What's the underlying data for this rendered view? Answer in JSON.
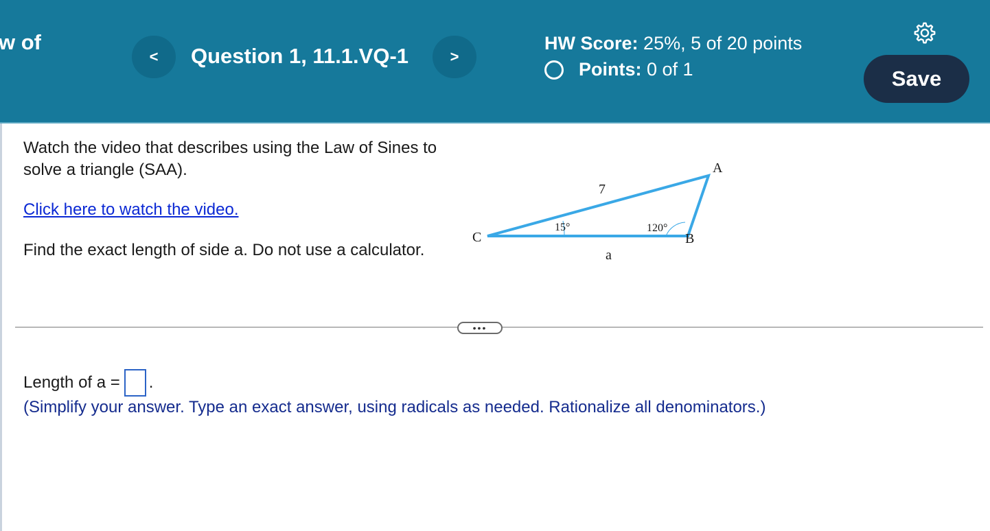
{
  "header": {
    "question_count_fragment": "w of",
    "prev_label": "<",
    "next_label": ">",
    "question_title": "Question 1, 11.1.VQ-1",
    "hw_score_label": "HW Score:",
    "hw_score_value": "25%, 5 of 20 points",
    "points_label": "Points:",
    "points_value": "0 of 1",
    "save_label": "Save",
    "settings_icon": "gear-icon"
  },
  "question": {
    "intro": "Watch the video that describes using the Law of Sines to solve a triangle (SAA).",
    "video_link": "Click here to watch the video.",
    "prompt": "Find the exact length of side a. Do not use a calculator."
  },
  "figure": {
    "vertex_a": "A",
    "vertex_b": "B",
    "vertex_c": "C",
    "side_ca": "7",
    "side_cb": "a",
    "angle_c": "15°",
    "angle_b": "120°",
    "stroke_color": "#3aa8e6"
  },
  "divider": {
    "more_label": "•••"
  },
  "answer": {
    "label": "Length of a =",
    "value": "",
    "suffix": ".",
    "hint": "(Simplify your answer. Type an exact answer, using radicals as needed. Rationalize all denominators.)"
  }
}
